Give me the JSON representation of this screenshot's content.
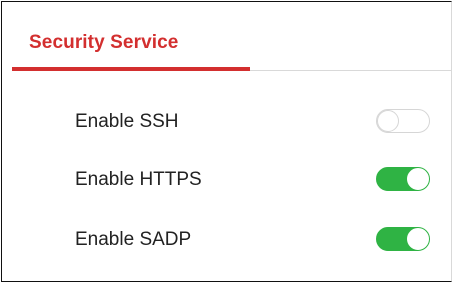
{
  "tabs": [
    {
      "label": "Security Service",
      "active": true
    }
  ],
  "settings": [
    {
      "label": "Enable SSH",
      "enabled": false
    },
    {
      "label": "Enable HTTPS",
      "enabled": true
    },
    {
      "label": "Enable SADP",
      "enabled": true
    }
  ],
  "colors": {
    "accent": "#d32f2f",
    "toggle_on": "#2fb344",
    "toggle_off_border": "#d6d6d6"
  }
}
